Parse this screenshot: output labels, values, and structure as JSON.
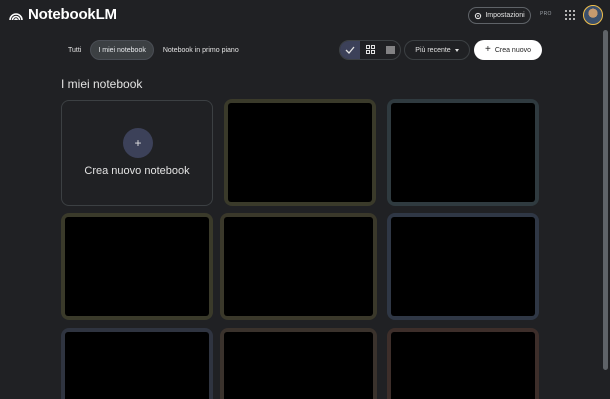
{
  "app": {
    "name": "NotebookLM",
    "logo_icon": "notebooklm-logo-icon"
  },
  "header": {
    "settings_label": "Impostazioni",
    "settings_icon": "gear-icon",
    "plan_badge": "PRO",
    "apps_icon": "apps-grid-icon",
    "avatar_icon": "user-avatar"
  },
  "tabs": [
    {
      "label": "Tutti",
      "active": false
    },
    {
      "label": "I miei notebook",
      "active": true
    },
    {
      "label": "Notebook in primo piano",
      "active": false
    }
  ],
  "toolbar": {
    "view_modes": [
      {
        "icon": "checkmark-icon",
        "active": true
      },
      {
        "icon": "grid-view-icon",
        "active": false
      },
      {
        "icon": "list-view-icon",
        "active": false
      }
    ],
    "sort_label": "Più recente",
    "create_label": "Crea nuovo"
  },
  "main": {
    "section_title": "I miei notebook",
    "new_notebook_label": "Crea nuovo notebook",
    "notebook_cards": [
      {
        "accent": "#3a3a2a"
      },
      {
        "accent": "#2f3a3f"
      },
      {
        "accent": "#3a3a2a"
      },
      {
        "accent": "#3a382a"
      },
      {
        "accent": "#2f3745"
      },
      {
        "accent": "#2f3440"
      },
      {
        "accent": "#3a322c"
      },
      {
        "accent": "#3d2e2a"
      }
    ]
  },
  "colors": {
    "background": "#202124",
    "accent_segment": "#3c4159",
    "primary_button": "#ffffff"
  }
}
